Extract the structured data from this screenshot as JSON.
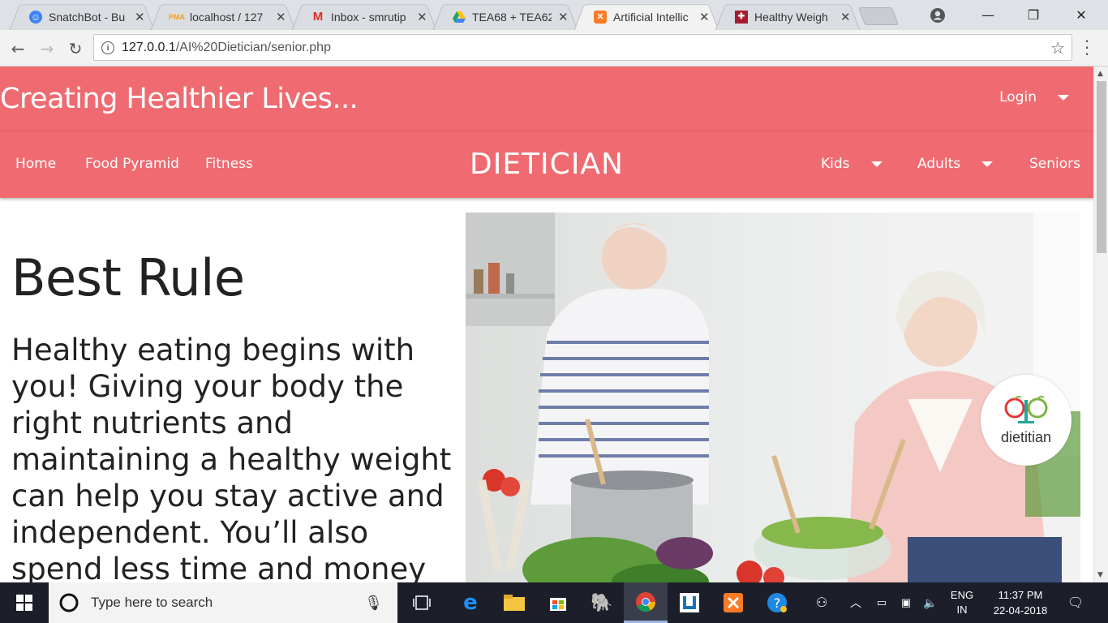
{
  "browser": {
    "tabs": [
      {
        "title": "SnatchBot - Bu",
        "icon": "snatchbot-icon",
        "color": "#3b82f6"
      },
      {
        "title": "localhost / 127",
        "icon": "phpmyadmin-icon",
        "color": "#f0a030"
      },
      {
        "title": "Inbox - smrutip",
        "icon": "gmail-icon",
        "color": "#d93025"
      },
      {
        "title": "TEA68 + TEA62",
        "icon": "google-drive-icon",
        "color": "#1fa463"
      },
      {
        "title": "Artificial Intellic",
        "icon": "xampp-icon",
        "color": "#fb7a24",
        "active": true
      },
      {
        "title": "Healthy Weigh",
        "icon": "harvard-icon",
        "color": "#a51c30"
      }
    ],
    "url_host": "127.0.0.1",
    "url_path": "/AI%20Dietician/senior.php"
  },
  "site": {
    "tagline": "Creating Healthier Lives...",
    "login_label": "Login",
    "brand": "DIETICIAN",
    "nav_left": [
      "Home",
      "Food Pyramid",
      "Fitness"
    ],
    "nav_right": [
      {
        "label": "Kids",
        "dropdown": true
      },
      {
        "label": "Adults",
        "dropdown": true
      },
      {
        "label": "Seniors",
        "dropdown": false
      }
    ],
    "accent_color": "#ef6b71"
  },
  "content": {
    "heading": "Best Rule",
    "paragraph": "Healthy eating begins with you! Giving your body the right nutrients and maintaining a healthy weight can help you stay active and independent. You’ll also spend less time and money",
    "logo_text": "dietitian"
  },
  "taskbar": {
    "search_placeholder": "Type here to search",
    "language": "ENG",
    "region": "IN",
    "time": "11:37 PM",
    "date": "22-04-2018"
  }
}
